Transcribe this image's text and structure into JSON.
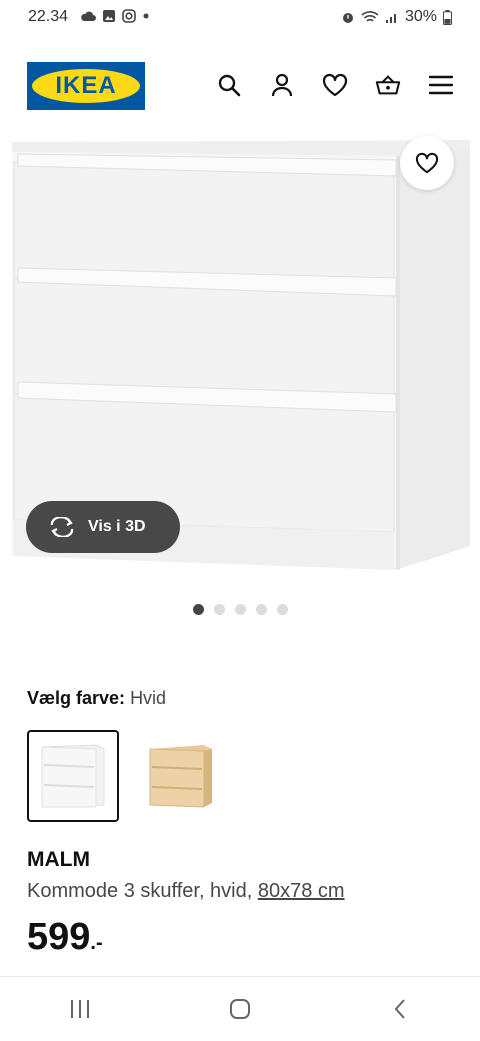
{
  "status": {
    "time": "22.34",
    "battery": "30%"
  },
  "header": {
    "logo_text": "IKEA",
    "icons": [
      "search-icon",
      "user-icon",
      "heart-icon",
      "basket-icon",
      "menu-icon"
    ]
  },
  "gallery": {
    "view3d_label": "Vis i 3D",
    "dot_count": 5,
    "active_dot": 1
  },
  "color_picker": {
    "label": "Vælg farve:",
    "value": "Hvid",
    "options": [
      "white",
      "oak"
    ]
  },
  "product": {
    "name": "MALM",
    "description_main": "Kommode 3 skuffer, hvid, ",
    "dimensions": "80x78 cm",
    "price": "599",
    "price_suffix": ".-"
  },
  "colors": {
    "ikea_blue": "#0058a3",
    "ikea_yellow": "#fbd914",
    "dark_pill": "#484848"
  }
}
